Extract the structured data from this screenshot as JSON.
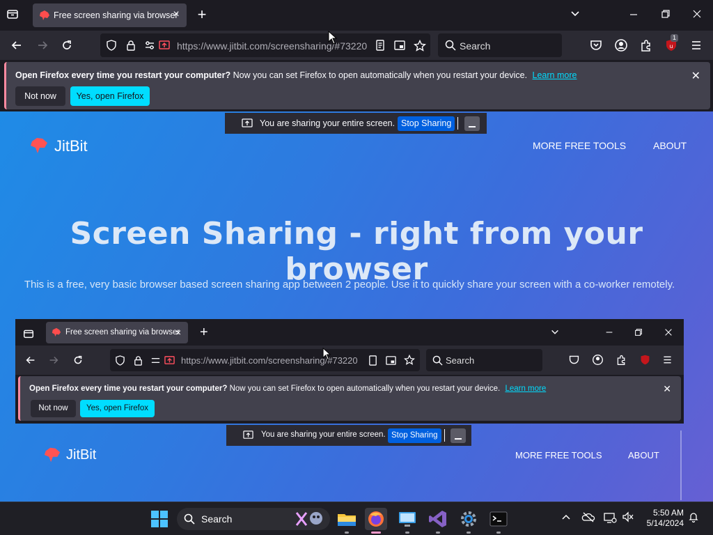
{
  "browser": {
    "tab_title": "Free screen sharing via browser",
    "url": "https://www.jitbit.com/screensharing/#73220",
    "search_placeholder": "Search",
    "extension_badge": "1"
  },
  "notification": {
    "bold_text": "Open Firefox every time you restart your computer?",
    "text": "Now you can set Firefox to open automatically when you restart your device.",
    "link": "Learn more",
    "not_now": "Not now",
    "yes": "Yes, open Firefox"
  },
  "share_bar": {
    "text": "You are sharing your entire screen.",
    "stop": "Stop Sharing"
  },
  "page": {
    "logo": "JitBit",
    "nav": [
      "MORE FREE TOOLS",
      "ABOUT"
    ],
    "title": "Screen Sharing - right from your browser",
    "subtitle": "This is a free, very basic browser based screen sharing app between 2 people. Use it to quickly share your screen with a co-worker remotely."
  },
  "taskbar": {
    "search_placeholder": "Search",
    "time": "5:50 AM",
    "date": "5/14/2024"
  },
  "colors": {
    "accent": "#00ddff",
    "stop_button": "#0060df",
    "notification_border": "#ff8aa0"
  }
}
